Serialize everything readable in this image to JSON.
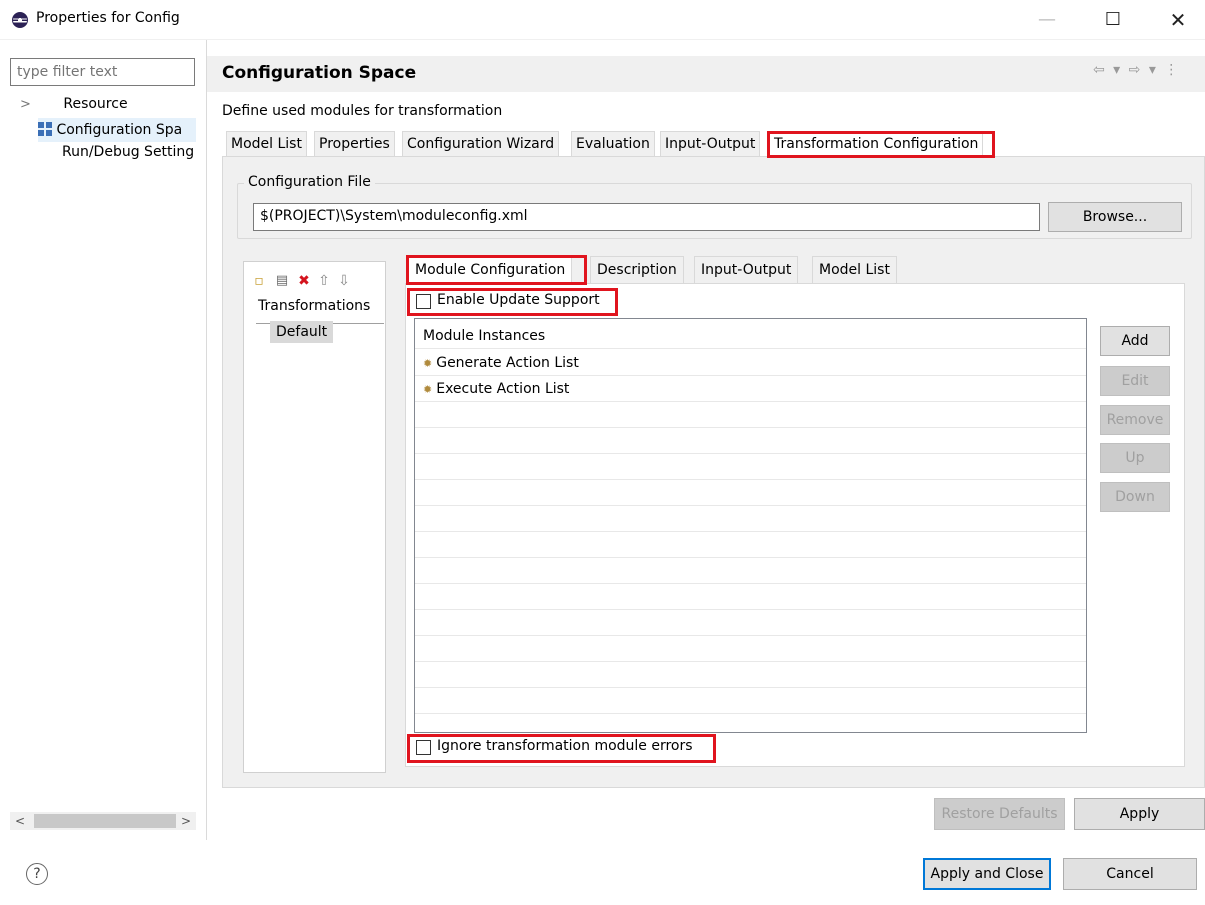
{
  "window": {
    "title": "Properties for Config",
    "minimize_glyph": "—",
    "maximize_glyph": "☐",
    "close_glyph": "✕"
  },
  "left_nav": {
    "filter_placeholder": "type filter text",
    "items": [
      {
        "label": "Resource",
        "expander": ">"
      },
      {
        "label": "Configuration Spa\u0003",
        "display": "Configuration Spa"
      },
      {
        "label": "Run/Debug Setting"
      }
    ],
    "scroll_left": "<",
    "scroll_right": ">"
  },
  "page": {
    "title": "Configuration Space",
    "description": "Define used modules for transformation",
    "nav_glyphs": "⇦ ▾ ⇨ ▾ ⋮"
  },
  "outer_tabs": [
    "Model List",
    "Properties",
    "Configuration Wizard",
    "Evaluation",
    "Input-Output",
    "Transformation Configuration"
  ],
  "config_file": {
    "legend": "Configuration File",
    "value": "$(PROJECT)\\System\\moduleconfig.xml",
    "browse_label": "Browse..."
  },
  "transformations": {
    "header": "Transformations",
    "items": [
      "Default"
    ],
    "toolbar_icons": [
      "new-icon",
      "copy-icon",
      "delete-icon",
      "move-up-icon",
      "move-down-icon"
    ]
  },
  "inner_tabs": [
    "Module Configuration",
    "Description",
    "Input-Output",
    "Model List"
  ],
  "module_config": {
    "enable_update_label": "Enable Update Support",
    "enable_update_checked": false,
    "table_header": "Module Instances",
    "modules": [
      "Generate Action List",
      "Execute Action List"
    ],
    "ignore_errors_label": "Ignore transformation module errors",
    "ignore_errors_checked": false,
    "buttons": {
      "add": "Add",
      "edit": "Edit",
      "remove": "Remove",
      "up": "Up",
      "down": "Down"
    }
  },
  "footer": {
    "restore_defaults": "Restore Defaults",
    "apply": "Apply",
    "apply_and_close": "Apply and Close",
    "cancel": "Cancel",
    "help_glyph": "?"
  },
  "colors": {
    "highlight": "#e0141e",
    "selection": "#e5f1fb",
    "default_button_border": "#0078d7"
  }
}
